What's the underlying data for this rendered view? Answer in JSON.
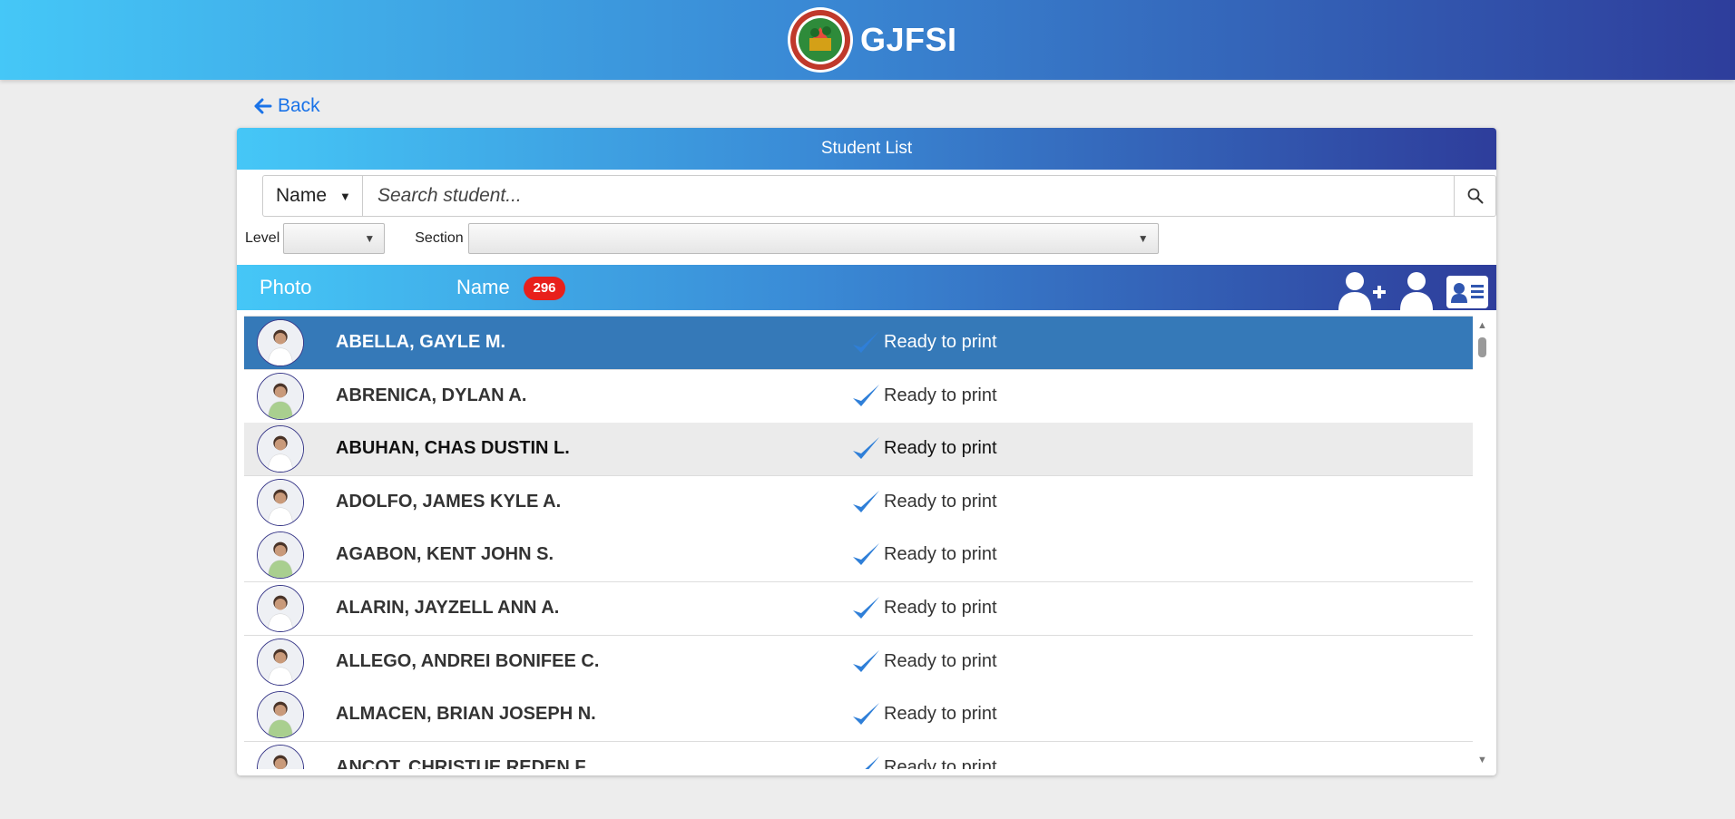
{
  "app": {
    "brand_name": "GJFSI",
    "logo_icon": "school-seal-logo"
  },
  "nav": {
    "back_label": "Back"
  },
  "card": {
    "title": "Student List"
  },
  "search": {
    "type_value": "Name",
    "placeholder": "Search student..."
  },
  "filters": {
    "level_label": "Level",
    "level_value": "",
    "section_label": "Section",
    "section_value": ""
  },
  "table": {
    "col_photo": "Photo",
    "col_name": "Name",
    "count": "296",
    "header_icons": [
      "add-user-icon",
      "user-icon",
      "id-card-icon"
    ]
  },
  "students": [
    {
      "name": "ABELLA, GAYLE M.",
      "status": "Ready to print",
      "state": "selected"
    },
    {
      "name": "ABRENICA, DYLAN A.",
      "status": "Ready to print",
      "state": ""
    },
    {
      "name": "ABUHAN, CHAS DUSTIN L.",
      "status": "Ready to print",
      "state": "hover"
    },
    {
      "name": "ADOLFO, JAMES KYLE A.",
      "status": "Ready to print",
      "state": ""
    },
    {
      "name": "AGABON, KENT JOHN S.",
      "status": "Ready to print",
      "state": ""
    },
    {
      "name": "ALARIN, JAYZELL ANN A.",
      "status": "Ready to print",
      "state": ""
    },
    {
      "name": "ALLEGO, ANDREI BONIFEE C.",
      "status": "Ready to print",
      "state": ""
    },
    {
      "name": "ALMACEN, BRIAN JOSEPH N.",
      "status": "Ready to print",
      "state": ""
    },
    {
      "name": "ANCOT, CHRISTUE REDEN F.",
      "status": "Ready to print",
      "state": ""
    }
  ],
  "colors": {
    "gradient_start": "#45c7f7",
    "gradient_end": "#2e3d9b",
    "selected_row": "#3579b8",
    "badge": "#e8201c",
    "check": "#2f7fd8",
    "link": "#1a73e8"
  }
}
